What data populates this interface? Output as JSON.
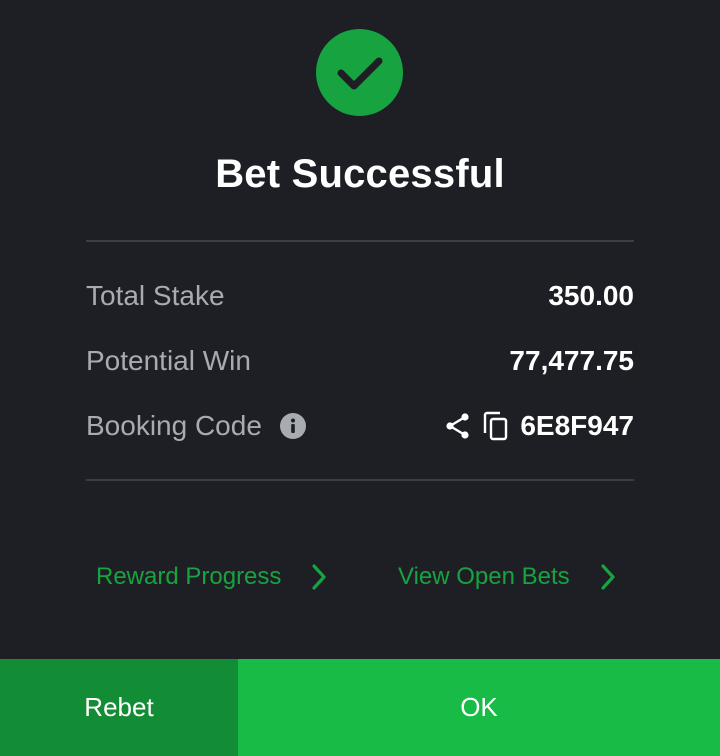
{
  "dialog": {
    "icon": "checkmark-circle-icon",
    "title": "Bet Successful"
  },
  "details": {
    "total_stake": {
      "label": "Total Stake",
      "value": "350.00"
    },
    "potential_win": {
      "label": "Potential Win",
      "value": "77,477.75"
    },
    "booking_code": {
      "label": "Booking Code",
      "value": "6E8F947",
      "icons": [
        "info-icon",
        "share-icon",
        "copy-icon"
      ]
    }
  },
  "links": {
    "reward_progress": "Reward Progress",
    "view_open_bets": "View Open Bets"
  },
  "buttons": {
    "rebet": "Rebet",
    "ok": "OK"
  },
  "colors": {
    "background": "#1d1f25",
    "accent_green": "#17a33f",
    "ok_button": "#17bb45",
    "rebet_button": "#138c36"
  }
}
